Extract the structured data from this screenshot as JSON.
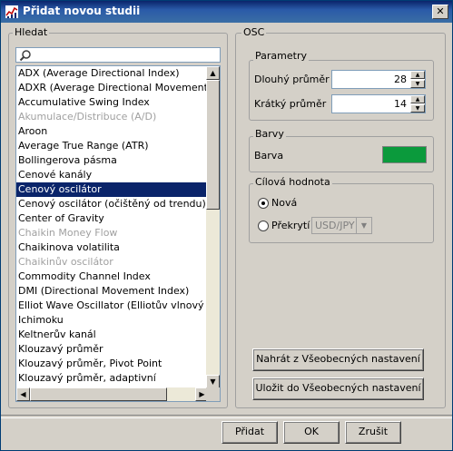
{
  "window": {
    "title": "Přidat novou studii",
    "close_glyph": "✕"
  },
  "left": {
    "group_title": "Hledat",
    "search": {
      "value": "",
      "placeholder": ""
    },
    "items": [
      {
        "label": "ADX (Average Directional Index)",
        "state": "normal"
      },
      {
        "label": "ADXR (Average Directional Movement Index",
        "state": "normal"
      },
      {
        "label": "Accumulative Swing Index",
        "state": "normal"
      },
      {
        "label": "Akumulace/Distribuce (A/D)",
        "state": "disabled"
      },
      {
        "label": "Aroon",
        "state": "normal"
      },
      {
        "label": "Average True Range (ATR)",
        "state": "normal"
      },
      {
        "label": "Bollingerova pásma",
        "state": "normal"
      },
      {
        "label": "Cenové kanály",
        "state": "normal"
      },
      {
        "label": "Cenový oscilátor",
        "state": "selected"
      },
      {
        "label": "Cenový oscilátor (očištěný od trendu)",
        "state": "normal"
      },
      {
        "label": "Center of Gravity",
        "state": "normal"
      },
      {
        "label": "Chaikin Money Flow",
        "state": "disabled"
      },
      {
        "label": "Chaikinova volatilita",
        "state": "normal"
      },
      {
        "label": "Chaikinův oscilátor",
        "state": "disabled"
      },
      {
        "label": "Commodity Channel Index",
        "state": "normal"
      },
      {
        "label": "DMI (Directional Movement Index)",
        "state": "normal"
      },
      {
        "label": "Elliot Wave Oscillator (Elliotův vlnový oscilát",
        "state": "normal"
      },
      {
        "label": "Ichimoku",
        "state": "normal"
      },
      {
        "label": "Keltnerův kanál",
        "state": "normal"
      },
      {
        "label": "Klouzavý průměr",
        "state": "normal"
      },
      {
        "label": "Klouzavý průměr, Pivot Point",
        "state": "normal"
      },
      {
        "label": "Klouzavý průměr, adaptivní",
        "state": "normal"
      }
    ]
  },
  "right": {
    "group_title": "OSC",
    "params": {
      "title": "Parametry",
      "long_label": "Dlouhý průměr",
      "long_value": "28",
      "short_label": "Krátký průměr",
      "short_value": "14"
    },
    "colors": {
      "title": "Barvy",
      "color_label": "Barva",
      "color_value": "#0b9a3c"
    },
    "target": {
      "title": "Cílová hodnota",
      "option_new": "Nová",
      "option_overlay": "Překrytí",
      "overlay_select": "USD/JPY",
      "selected": "new"
    },
    "load_button": "Nahrát z Všeobecných nastavení",
    "save_button": "Uložit do Všeobecných nastavení"
  },
  "footer": {
    "add": "Přidat",
    "ok": "OK",
    "cancel": "Zrušit"
  },
  "colors": {
    "title_bar": "#0a246a",
    "selection": "#0a246a",
    "dialog_bg": "#d4d0c8"
  }
}
